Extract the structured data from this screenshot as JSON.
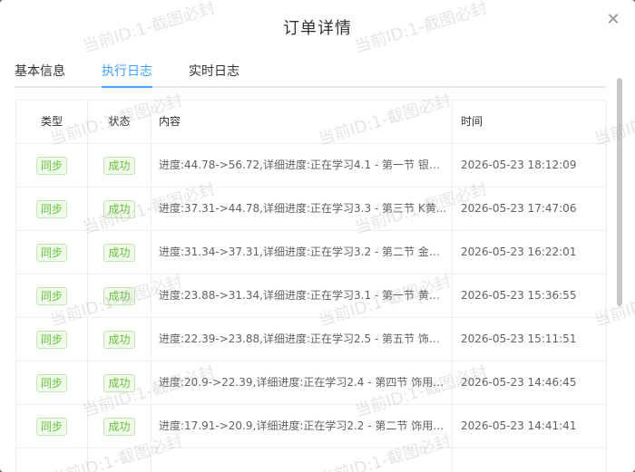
{
  "dialog": {
    "title": "订单详情"
  },
  "tabs": [
    {
      "label": "基本信息",
      "active": false
    },
    {
      "label": "执行日志",
      "active": true
    },
    {
      "label": "实时日志",
      "active": false
    }
  ],
  "table": {
    "headers": {
      "type": "类型",
      "status": "状态",
      "content": "内容",
      "time": "时间"
    },
    "rows": [
      {
        "type": "同步",
        "status": "成功",
        "content": "进度:44.78->56.72,详细进度:正在学习4.1 - 第一节 银的...",
        "time": "2026-05-23 18:12:09"
      },
      {
        "type": "同步",
        "status": "成功",
        "content": "进度:37.31->44.78,详细进度:正在学习3.3 - 第三节 K黄...",
        "time": "2026-05-23 17:47:06"
      },
      {
        "type": "同步",
        "status": "成功",
        "content": "进度:31.34->37.31,详细进度:正在学习3.2 - 第二节 金的...",
        "time": "2026-05-23 16:22:01"
      },
      {
        "type": "同步",
        "status": "成功",
        "content": "进度:23.88->31.34,详细进度:正在学习3.1 - 第一节 黄金...",
        "time": "2026-05-23 15:36:55"
      },
      {
        "type": "同步",
        "status": "成功",
        "content": "进度:22.39->23.88,详细进度:正在学习2.5 - 第五节 饰用...",
        "time": "2026-05-23 15:11:51"
      },
      {
        "type": "同步",
        "status": "成功",
        "content": "进度:20.9->22.39,详细进度:正在学习2.4 - 第四节 饰用贵...",
        "time": "2026-05-23 14:46:45"
      },
      {
        "type": "同步",
        "status": "成功",
        "content": "进度:17.91->20.9,详细进度:正在学习2.2 - 第二节 饰用贵...",
        "time": "2026-05-23 14:41:41"
      }
    ]
  },
  "colors": {
    "accent": "#409eff",
    "success": "#67c23a"
  },
  "watermark": "当前ID:1-截图必封"
}
